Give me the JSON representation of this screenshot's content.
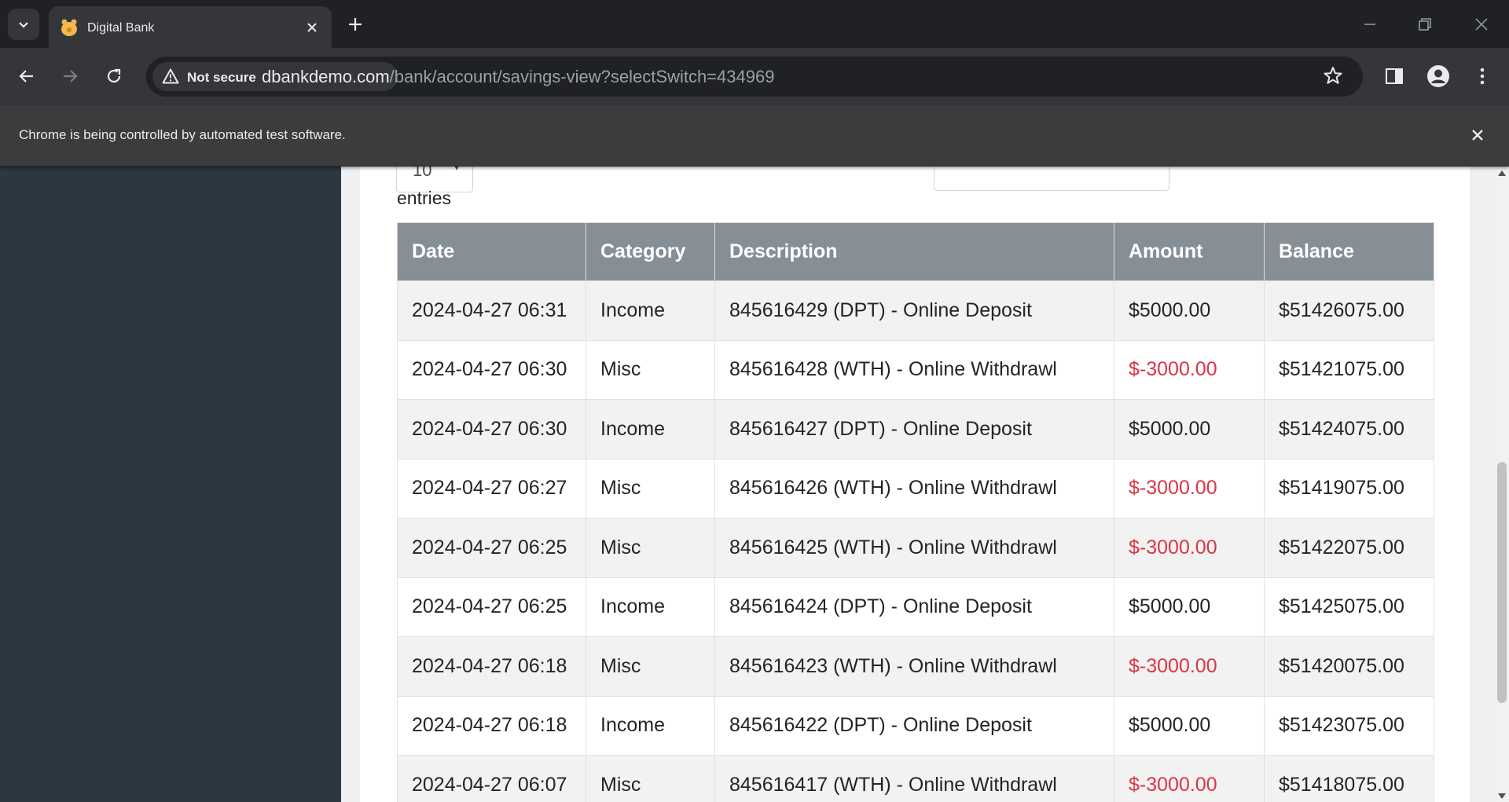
{
  "browser": {
    "tab_title": "Digital Bank",
    "security_label": "Not secure",
    "url_host": "dbankdemo.com",
    "url_path": "/bank/account/savings-view?selectSwitch=434969",
    "infobar_message": "Chrome is being controlled by automated test software."
  },
  "page": {
    "length_value": "10",
    "entries_label": "entries",
    "table": {
      "headers": [
        "Date",
        "Category",
        "Description",
        "Amount",
        "Balance"
      ],
      "rows": [
        {
          "date": "2024-04-27 06:31",
          "category": "Income",
          "description": "845616429 (DPT) - Online Deposit",
          "amount": "$5000.00",
          "balance": "$51426075.00"
        },
        {
          "date": "2024-04-27 06:30",
          "category": "Misc",
          "description": "845616428 (WTH) - Online Withdrawl",
          "amount": "$-3000.00",
          "balance": "$51421075.00"
        },
        {
          "date": "2024-04-27 06:30",
          "category": "Income",
          "description": "845616427 (DPT) - Online Deposit",
          "amount": "$5000.00",
          "balance": "$51424075.00"
        },
        {
          "date": "2024-04-27 06:27",
          "category": "Misc",
          "description": "845616426 (WTH) - Online Withdrawl",
          "amount": "$-3000.00",
          "balance": "$51419075.00"
        },
        {
          "date": "2024-04-27 06:25",
          "category": "Misc",
          "description": "845616425 (WTH) - Online Withdrawl",
          "amount": "$-3000.00",
          "balance": "$51422075.00"
        },
        {
          "date": "2024-04-27 06:25",
          "category": "Income",
          "description": "845616424 (DPT) - Online Deposit",
          "amount": "$5000.00",
          "balance": "$51425075.00"
        },
        {
          "date": "2024-04-27 06:18",
          "category": "Misc",
          "description": "845616423 (WTH) - Online Withdrawl",
          "amount": "$-3000.00",
          "balance": "$51420075.00"
        },
        {
          "date": "2024-04-27 06:18",
          "category": "Income",
          "description": "845616422 (DPT) - Online Deposit",
          "amount": "$5000.00",
          "balance": "$51423075.00"
        },
        {
          "date": "2024-04-27 06:07",
          "category": "Misc",
          "description": "845616417 (WTH) - Online Withdrawl",
          "amount": "$-3000.00",
          "balance": "$51418075.00"
        }
      ]
    }
  },
  "colors": {
    "negative_amount": "#dc3545",
    "table_header_bg": "#868e96",
    "sidebar_bg": "#2c3740"
  },
  "icons": [
    "tab-search-icon",
    "bank-favicon-icon",
    "close-tab-icon",
    "new-tab-icon",
    "minimize-icon",
    "restore-icon",
    "close-window-icon",
    "back-arrow-icon",
    "forward-arrow-icon",
    "reload-icon",
    "warning-icon",
    "bookmark-star-icon",
    "side-panel-icon",
    "profile-icon",
    "menu-kebab-icon",
    "close-infobar-icon"
  ]
}
